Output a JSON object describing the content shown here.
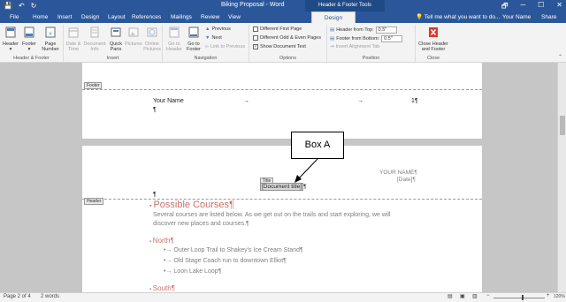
{
  "titlebar": {
    "save": "💾",
    "undo": "↶",
    "redo": "↻",
    "title": "Biking Proposal - Word",
    "context_tab": "Header & Footer Tools",
    "window_buttons": [
      "🗗",
      "─",
      "☐",
      "✕"
    ]
  },
  "tabs": [
    "File",
    "Home",
    "Insert",
    "Design",
    "Layout",
    "References",
    "Mailings",
    "Review",
    "View",
    "Design"
  ],
  "tellme": "💡 Tell me what you want to do...",
  "user": "Your Name",
  "share": "Share",
  "ribbon": {
    "header_footer_group": {
      "label": "Header & Footer",
      "header": "Header",
      "footer": "Footer",
      "page_number_1": "Page",
      "page_number_2": "Number"
    },
    "insert_group": {
      "label": "Insert",
      "date_time_1": "Date &",
      "date_time_2": "Time",
      "doc_info_1": "Document",
      "doc_info_2": "Info",
      "quick_parts_1": "Quick",
      "quick_parts_2": "Parts",
      "pictures": "Pictures",
      "online_pictures_1": "Online",
      "online_pictures_2": "Pictures"
    },
    "navigation_group": {
      "label": "Navigation",
      "goto_header_1": "Go to",
      "goto_header_2": "Header",
      "goto_footer_1": "Go to",
      "goto_footer_2": "Footer",
      "previous": "Previous",
      "next": "Next",
      "link_previous": "Link to Previous"
    },
    "options_group": {
      "label": "Options",
      "different_first_page": "Different First Page",
      "different_odd_even": "Different Odd & Even Pages",
      "show_doc_text": "Show Document Text"
    },
    "position_group": {
      "label": "Position",
      "header_from_top": "Header from Top:",
      "header_value": "0.5\"",
      "footer_from_bottom": "Footer from Bottom:",
      "footer_value": "0.5\"",
      "insert_alignment_tab": "Insert Alignment Tab"
    },
    "close_group": {
      "label": "Close",
      "close_1": "Close Header",
      "close_2": "and Footer"
    }
  },
  "document": {
    "footer_tag": "Footer",
    "footer_name": "Your Name",
    "footer_arrow1": "→",
    "footer_arrow2": "→",
    "footer_page": "1¶",
    "footer_para": "¶",
    "header_tag": "Header",
    "header_name": "YOUR NAME¶",
    "header_date": "[Date]¶",
    "title_tag": "Title",
    "doc_title_ctl": "[Document title]",
    "pilcrow": "¶",
    "para_mark": "¶",
    "heading": "Possible Courses¶",
    "body_line1": "Several courses are listed below. As we get out on the trails and start exploring, we will",
    "body_line2": "discover new places and courses.¶",
    "north": "North¶",
    "items": [
      "Outer Loop Trail to Shakey's Ice Cream Stand¶",
      "Old Stage Coach run to downtown Elliot¶",
      "Loon Lake Loop¶"
    ],
    "south": "South¶"
  },
  "callout": "Box A",
  "status": {
    "page": "Page 2 of 4",
    "words": "2 words",
    "zoom": "120%"
  }
}
